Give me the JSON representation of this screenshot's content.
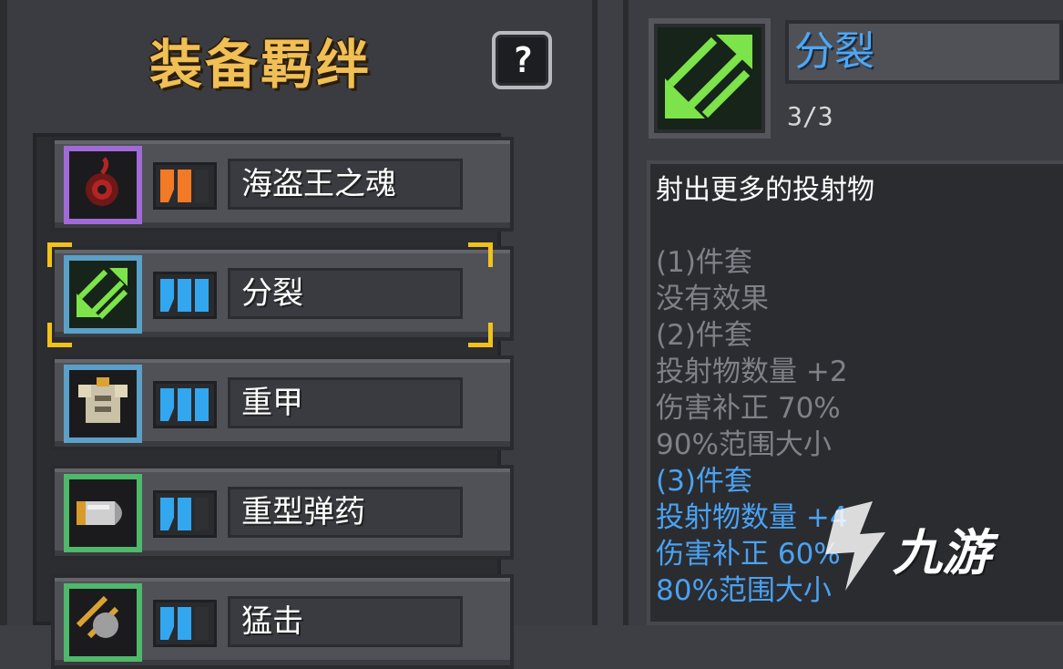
{
  "panel": {
    "title": "装备羁绊",
    "help_label": "?"
  },
  "bonds": [
    {
      "name": "海盗王之魂",
      "tier_filled": 2,
      "tier_total": 3,
      "tier_color": "#f27a26",
      "frame_color": "#a16ad6",
      "icon": "pirate-soul-icon"
    },
    {
      "name": "分裂",
      "tier_filled": 3,
      "tier_total": 3,
      "tier_color": "#33a6f0",
      "frame_color": "#5aa0c8",
      "icon": "split-arrows-icon",
      "selected": true
    },
    {
      "name": "重甲",
      "tier_filled": 3,
      "tier_total": 3,
      "tier_color": "#33a6f0",
      "frame_color": "#5aa0c8",
      "icon": "heavy-armor-icon"
    },
    {
      "name": "重型弹药",
      "tier_filled": 2,
      "tier_total": 3,
      "tier_color": "#33a6f0",
      "frame_color": "#4fb86a",
      "icon": "heavy-ammo-icon"
    },
    {
      "name": "猛击",
      "tier_filled": 2,
      "tier_total": 3,
      "tier_color": "#33a6f0",
      "frame_color": "#4fb86a",
      "icon": "smash-icon"
    }
  ],
  "detail": {
    "title": "分裂",
    "count": "3/3",
    "description": "射出更多的投射物",
    "lines": [
      {
        "text": "(1)件套",
        "active": false
      },
      {
        "text": "没有效果",
        "active": false
      },
      {
        "text": "(2)件套",
        "active": false
      },
      {
        "text": "投射物数量 +2",
        "active": false
      },
      {
        "text": "伤害补正 70%",
        "active": false
      },
      {
        "text": "90%范围大小",
        "active": false
      },
      {
        "text": "(3)件套",
        "active": true
      },
      {
        "text": "投射物数量 +4",
        "active": true
      },
      {
        "text": "伤害补正 60%",
        "active": true
      },
      {
        "text": "80%范围大小",
        "active": true
      }
    ]
  },
  "watermark": {
    "text": "九游"
  },
  "colors": {
    "title_gold": "#f0bf55",
    "active_blue": "#4aa2f2",
    "inactive_gray": "#7f8187",
    "selection_yellow": "#f1c21b"
  }
}
